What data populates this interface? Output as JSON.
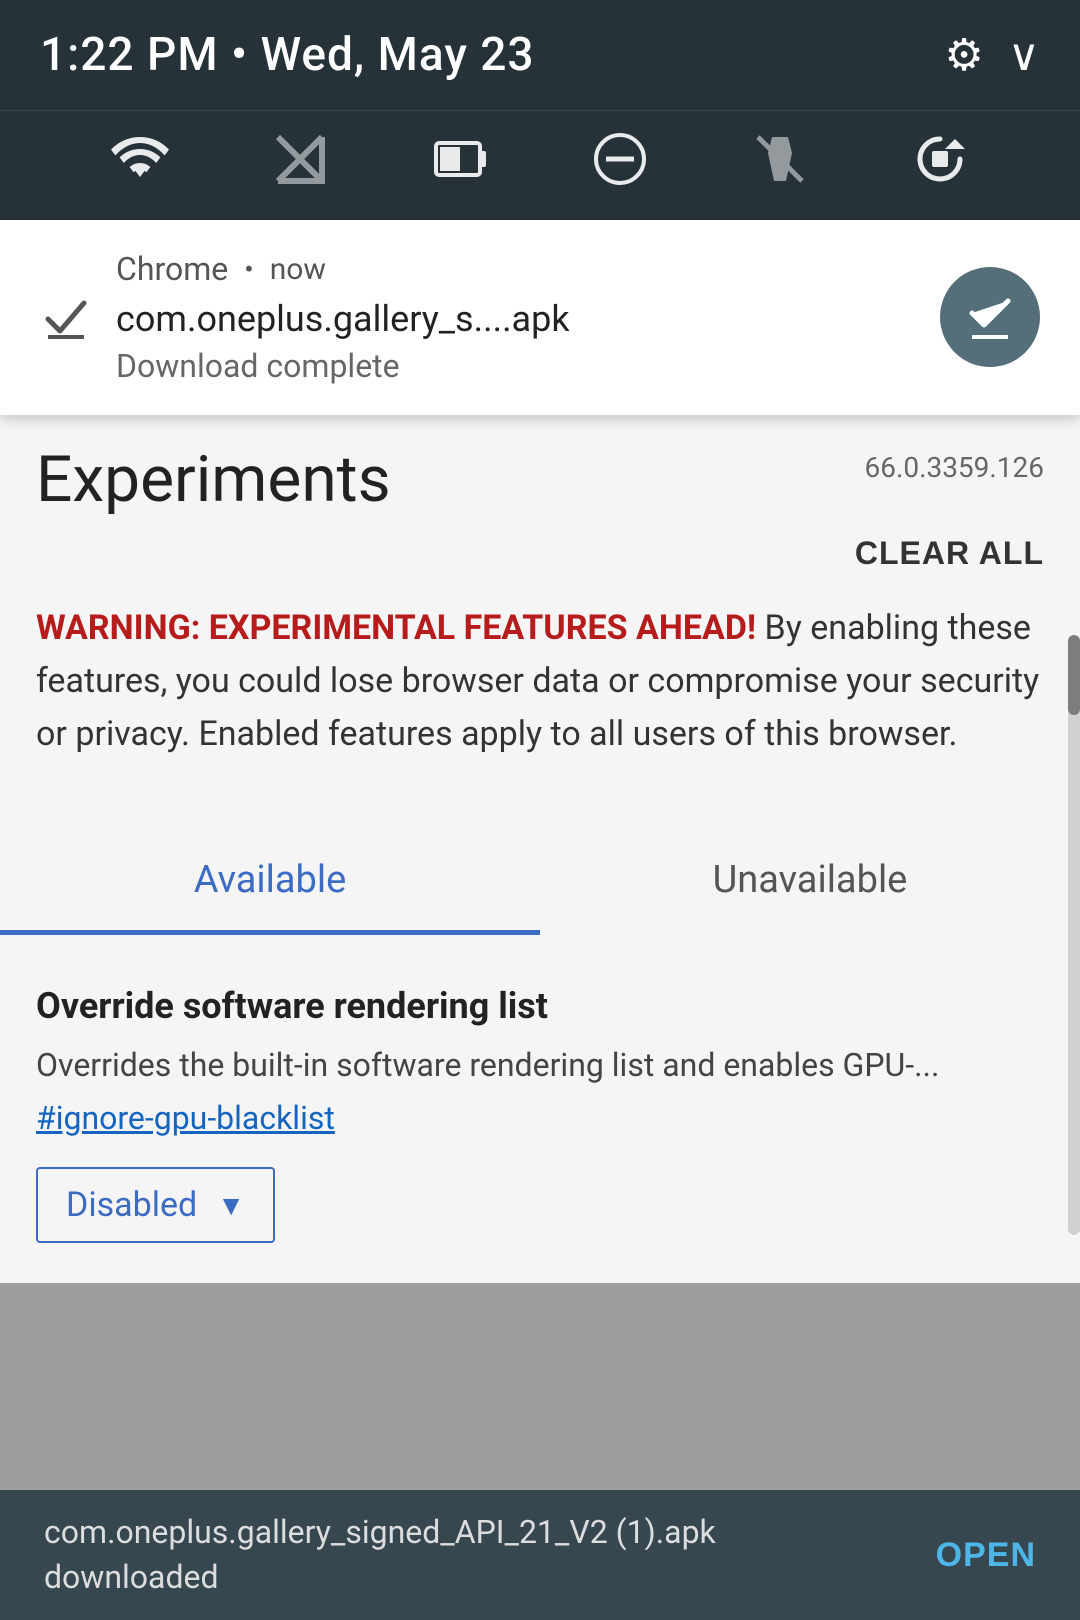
{
  "statusBar": {
    "time": "1:22 PM",
    "separator": "•",
    "date": "Wed, May 23"
  },
  "notificationIcons": {
    "wifi": "▼",
    "signal_off": "✕",
    "battery": "▭",
    "dnd": "⊖",
    "flashlight_off": "✕",
    "rotate": "⟳"
  },
  "settingsIcon": "⚙",
  "chevronDown": "∨",
  "notification": {
    "app": "Chrome",
    "separator": "•",
    "time": "now",
    "filename": "com.oneplus.gallery_s....apk",
    "status": "Download complete",
    "actionIcon": "check"
  },
  "experiments": {
    "title": "Experiments",
    "version": "66.0.3359.126",
    "clearAll": "CLEAR ALL",
    "warningHighlight": "WARNING: EXPERIMENTAL FEATURES AHEAD!",
    "warningBody": " By enabling these features, you could lose browser data or compromise your security or privacy. Enabled features apply to all users of this browser."
  },
  "tabs": [
    {
      "label": "Available",
      "active": true
    },
    {
      "label": "Unavailable",
      "active": false
    }
  ],
  "feature": {
    "title": "Override software rendering list",
    "description": "Overrides the built-in software rendering list and enables GPU-...",
    "link": "#ignore-gpu-blacklist",
    "dropdown": {
      "label": "Disabled",
      "arrow": "▼"
    }
  },
  "bottomBar": {
    "filename": "com.oneplus.gallery_signed_API_21_V2 (1).apk",
    "subtext": "downloaded",
    "openButton": "OPEN"
  }
}
